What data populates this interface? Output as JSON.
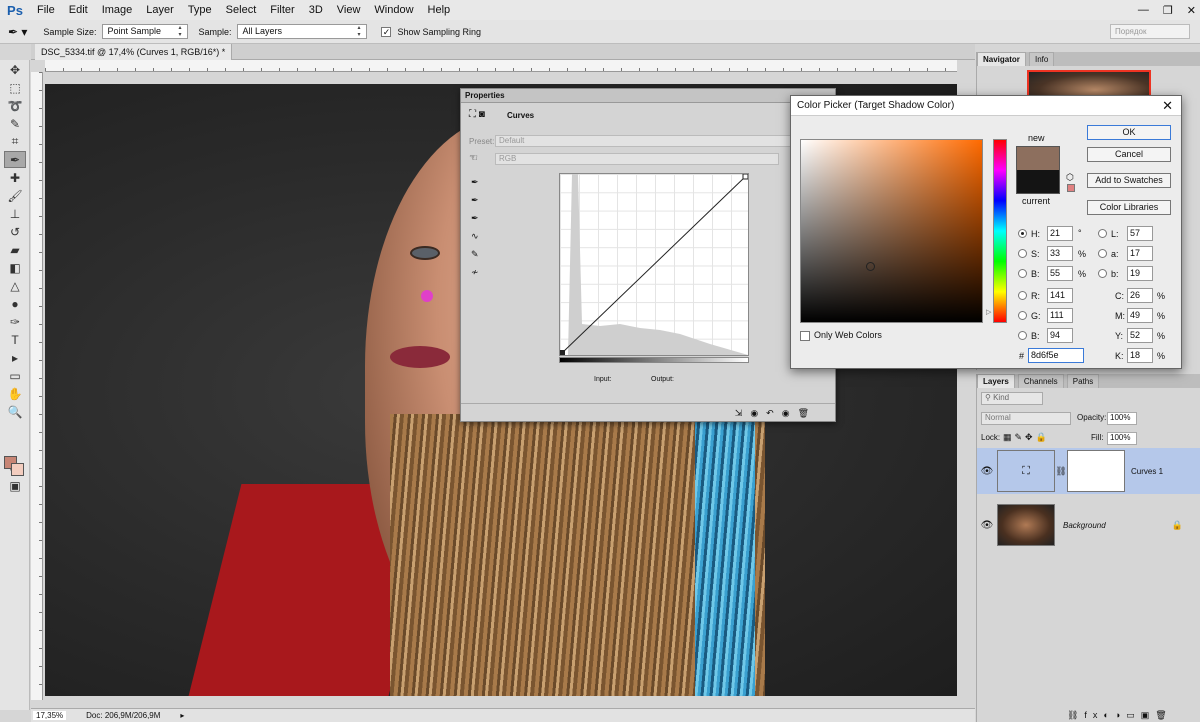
{
  "app": {
    "logo": "Ps"
  },
  "menu": [
    "File",
    "Edit",
    "Image",
    "Layer",
    "Type",
    "Select",
    "Filter",
    "3D",
    "View",
    "Window",
    "Help"
  ],
  "options": {
    "sample_size_label": "Sample Size:",
    "sample_size_value": "Point Sample",
    "sample_label": "Sample:",
    "sample_value": "All Layers",
    "show_ring_label": "Show Sampling Ring",
    "show_ring_checked": true,
    "workspace": "Порядок"
  },
  "document": {
    "tab_title": "DSC_5334.tif @ 17,4% (Curves 1, RGB/16*) *",
    "zoom": "17,35%",
    "doc_info": "Doc: 206,9M/206,9M"
  },
  "colors": {
    "foreground": "#c78575",
    "background": "#f3cdbf",
    "accent_selection": "#3a7ad8"
  },
  "navigator": {
    "tabs": [
      "Navigator",
      "Info"
    ]
  },
  "layers": {
    "tabs": [
      "Layers",
      "Channels",
      "Paths"
    ],
    "filter": "Kind",
    "blend_mode": "Normal",
    "opacity_label": "Opacity:",
    "opacity": "100%",
    "lock_label": "Lock:",
    "fill_label": "Fill:",
    "fill": "100%",
    "items": [
      {
        "name": "Curves 1",
        "type": "adjustment",
        "selected": true
      },
      {
        "name": "Background",
        "type": "image",
        "locked": true
      }
    ]
  },
  "properties": {
    "tab": "Properties",
    "title": "Curves",
    "preset_label": "Preset:",
    "preset_value": "Default",
    "channel": "RGB",
    "input_label": "Input:",
    "output_label": "Output:"
  },
  "color_picker": {
    "title": "Color Picker (Target Shadow Color)",
    "new_label": "new",
    "current_label": "current",
    "new_color": "#8d6f5e",
    "current_color": "#141414",
    "buttons": {
      "ok": "OK",
      "cancel": "Cancel",
      "add_swatches": "Add to Swatches",
      "libraries": "Color Libraries"
    },
    "only_web": "Only Web Colors",
    "hsb": [
      {
        "label": "H:",
        "value": "21",
        "unit": "°",
        "checked": true
      },
      {
        "label": "S:",
        "value": "33",
        "unit": "%"
      },
      {
        "label": "B:",
        "value": "55",
        "unit": "%"
      }
    ],
    "rgb": [
      {
        "label": "R:",
        "value": "141"
      },
      {
        "label": "G:",
        "value": "111"
      },
      {
        "label": "B:",
        "value": "94"
      }
    ],
    "lab": [
      {
        "label": "L:",
        "value": "57"
      },
      {
        "label": "a:",
        "value": "17"
      },
      {
        "label": "b:",
        "value": "19"
      }
    ],
    "cmyk": [
      {
        "label": "C:",
        "value": "26",
        "unit": "%"
      },
      {
        "label": "M:",
        "value": "49",
        "unit": "%"
      },
      {
        "label": "Y:",
        "value": "52",
        "unit": "%"
      },
      {
        "label": "K:",
        "value": "18",
        "unit": "%"
      }
    ],
    "hex_label": "#",
    "hex": "8d6f5e"
  }
}
